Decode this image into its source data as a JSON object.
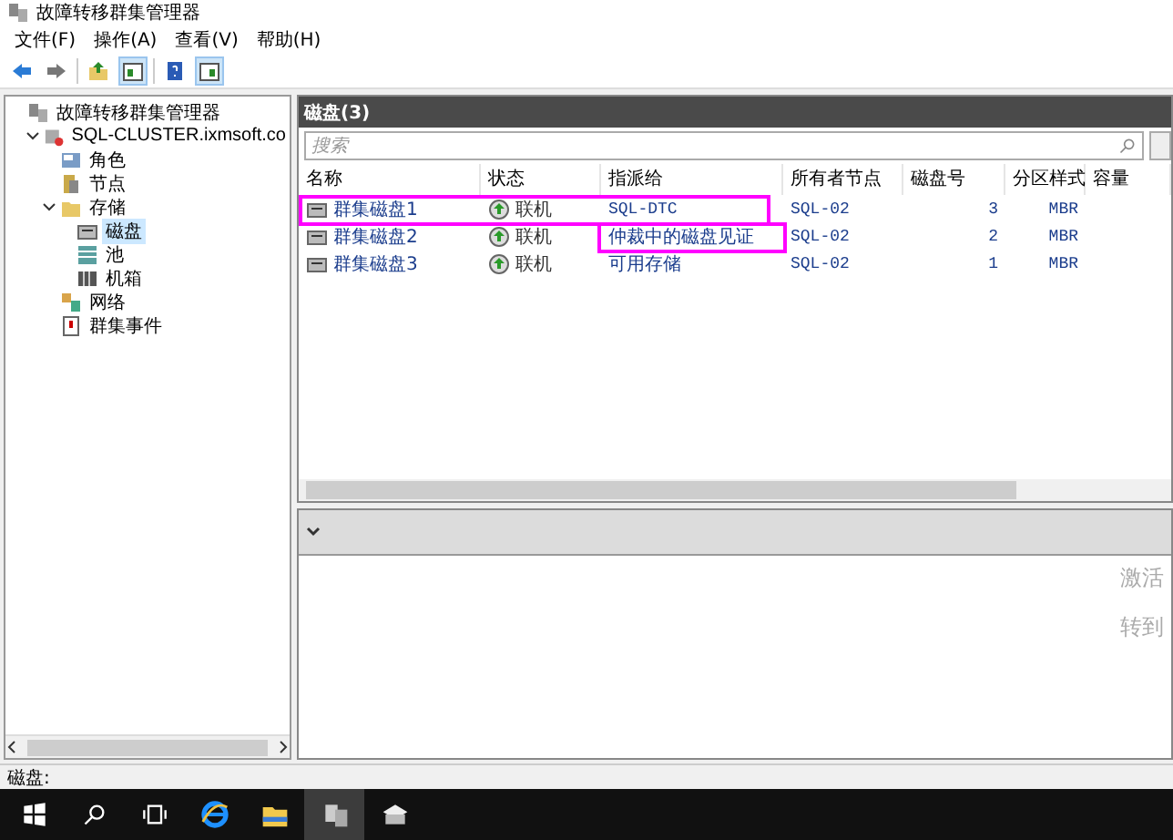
{
  "window": {
    "title": "故障转移群集管理器"
  },
  "menu": [
    "文件(F)",
    "操作(A)",
    "查看(V)",
    "帮助(H)"
  ],
  "toolbar": [
    {
      "kind": "back",
      "pressed": false
    },
    {
      "kind": "forward",
      "pressed": false
    },
    {
      "kind": "up",
      "pressed": false
    },
    {
      "kind": "tree",
      "pressed": true
    },
    {
      "kind": "help",
      "pressed": false
    },
    {
      "kind": "pane",
      "pressed": true
    }
  ],
  "tree": {
    "label": "故障转移群集管理器",
    "kind": "root",
    "selected": false,
    "children": [
      {
        "label": "SQL-CLUSTER.ixmsoft.co",
        "kind": "cluster",
        "selected": false,
        "expanded": true,
        "children": [
          {
            "label": "角色",
            "kind": "roles",
            "selected": false
          },
          {
            "label": "节点",
            "kind": "nodes",
            "selected": false
          },
          {
            "label": "存储",
            "kind": "storage",
            "selected": false,
            "expanded": true,
            "children": [
              {
                "label": "磁盘",
                "kind": "disk",
                "selected": true
              },
              {
                "label": "池",
                "kind": "pool",
                "selected": false
              },
              {
                "label": "机箱",
                "kind": "enclosure",
                "selected": false
              }
            ]
          },
          {
            "label": "网络",
            "kind": "network",
            "selected": false
          },
          {
            "label": "群集事件",
            "kind": "events",
            "selected": false
          }
        ]
      }
    ]
  },
  "disks": {
    "title": "磁盘(3)",
    "search": {
      "placeholder": "搜索"
    },
    "columns": [
      "名称",
      "状态",
      "指派给",
      "所有者节点",
      "磁盘号",
      "分区样式",
      "容量"
    ],
    "rows": [
      {
        "name": "群集磁盘1",
        "status": "联机",
        "assigned_to": "SQL-DTC",
        "owner": "SQL-02",
        "number": "3",
        "partition": "MBR",
        "mark_row": true,
        "mark_assigned": false
      },
      {
        "name": "群集磁盘2",
        "status": "联机",
        "assigned_to": "仲裁中的磁盘见证",
        "owner": "SQL-02",
        "number": "2",
        "partition": "MBR",
        "mark_row": false,
        "mark_assigned": true
      },
      {
        "name": "群集磁盘3",
        "status": "联机",
        "assigned_to": "可用存储",
        "owner": "SQL-02",
        "number": "1",
        "partition": "MBR",
        "mark_row": false,
        "mark_assigned": false
      }
    ]
  },
  "details": {
    "expanded": false
  },
  "status_bar": "磁盘:",
  "activation": [
    "激活",
    "转到"
  ],
  "taskbar": [
    {
      "kind": "start",
      "selected": false
    },
    {
      "kind": "search",
      "selected": false
    },
    {
      "kind": "taskview",
      "selected": false
    },
    {
      "kind": "browser",
      "selected": false
    },
    {
      "kind": "explorer",
      "selected": false
    },
    {
      "kind": "cluster",
      "selected": true
    },
    {
      "kind": "server",
      "selected": false
    }
  ]
}
